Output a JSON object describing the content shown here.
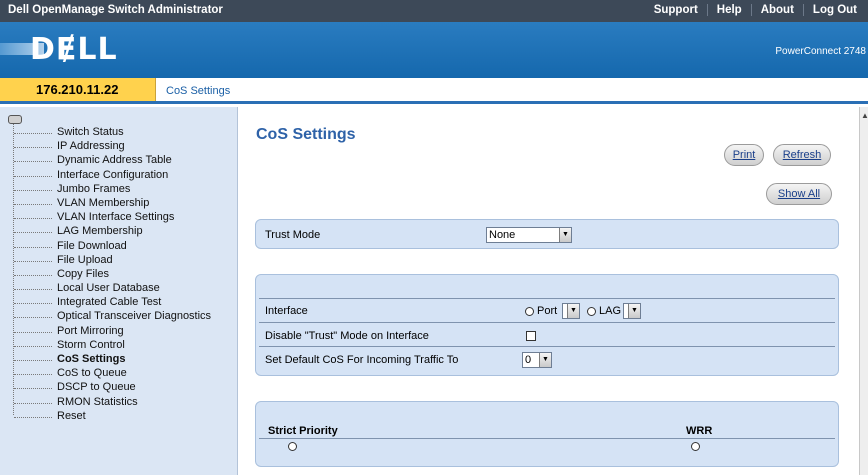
{
  "topbar": {
    "title": "Dell OpenManage Switch Administrator",
    "links": [
      "Support",
      "Help",
      "About",
      "Log Out"
    ]
  },
  "header": {
    "logo_text": "DɆLL",
    "model": "PowerConnect 2748"
  },
  "tabrow": {
    "ip": "176.210.11.22",
    "tab": "CoS Settings"
  },
  "nav": {
    "items": [
      "Switch Status",
      "IP Addressing",
      "Dynamic Address Table",
      "Interface Configuration",
      "Jumbo Frames",
      "VLAN Membership",
      "VLAN Interface Settings",
      "LAG Membership",
      "File Download",
      "File Upload",
      "Copy Files",
      "Local User Database",
      "Integrated Cable Test",
      "Optical Transceiver Diagnostics",
      "Port Mirroring",
      "Storm Control",
      "CoS Settings",
      "CoS to Queue",
      "DSCP to Queue",
      "RMON Statistics",
      "Reset"
    ],
    "active": "CoS Settings"
  },
  "content": {
    "title": "CoS Settings",
    "buttons": {
      "print": "Print",
      "refresh": "Refresh",
      "show_all": "Show All"
    },
    "trust": {
      "label": "Trust Mode",
      "value": "None"
    },
    "interface": {
      "label": "Interface",
      "port_label": "Port",
      "lag_label": "LAG",
      "disable_trust_label": "Disable \"Trust\" Mode on Interface",
      "default_cos_label": "Set Default CoS For Incoming Traffic To",
      "default_cos_value": "0"
    },
    "scheduling": {
      "strict_priority": "Strict Priority",
      "wrr": "WRR"
    }
  }
}
